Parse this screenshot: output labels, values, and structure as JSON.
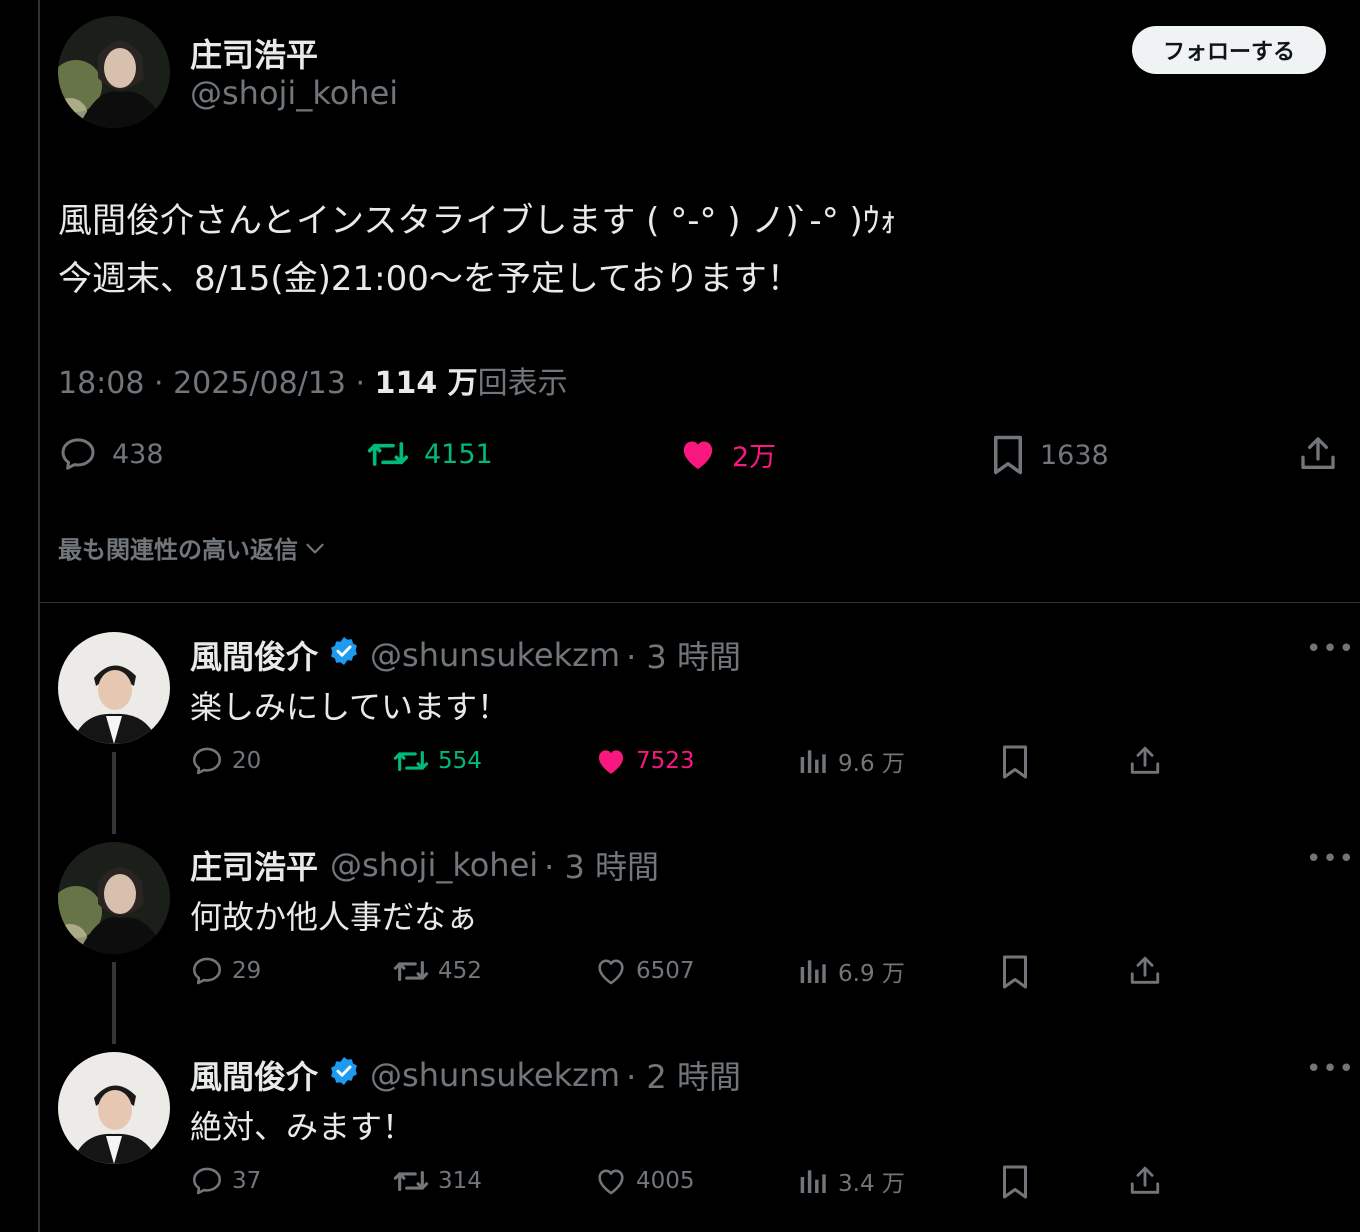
{
  "main_post": {
    "author_name": "庄司浩平",
    "author_handle": "@shoji_kohei",
    "follow_label": "フォローする",
    "text_line1": "風間俊介さんとインスタライブします ( °-° ) ノ) ̀-° )ｳｫ",
    "text_line2": "今週末、8/15(金)21:00～を予定しております！",
    "time": "18:08 · 2025/08/13 · ",
    "views_count": "114 万",
    "views_label": "回表示",
    "replies": "438",
    "reposts": "4151",
    "likes": "2万",
    "bookmarks": "1638"
  },
  "sort_label": "最も関連性の高い返信",
  "replies": [
    {
      "name": "風間俊介",
      "handle": "@shunsukekzm",
      "time": "· 3 時間",
      "text": "楽しみにしています！",
      "replies": "20",
      "reposts": "554",
      "likes": "7523",
      "views": "9.6 万",
      "liked": true,
      "reposted": true,
      "verified": true
    },
    {
      "name": "庄司浩平",
      "handle": "@shoji_kohei",
      "time": "· 3 時間",
      "text": "何故か他人事だなぁ",
      "replies": "29",
      "reposts": "452",
      "likes": "6507",
      "views": "6.9 万",
      "liked": false,
      "reposted": false,
      "verified": false
    },
    {
      "name": "風間俊介",
      "handle": "@shunsukekzm",
      "time": "· 2 時間",
      "text": "絶対、みます！",
      "replies": "37",
      "reposts": "314",
      "likes": "4005",
      "views": "3.4 万",
      "liked": false,
      "reposted": false,
      "verified": true
    }
  ],
  "colors": {
    "like_active": "#f91880",
    "repost_active": "#00ba7c",
    "verified": "#1d9bf0",
    "muted": "#71767b"
  }
}
